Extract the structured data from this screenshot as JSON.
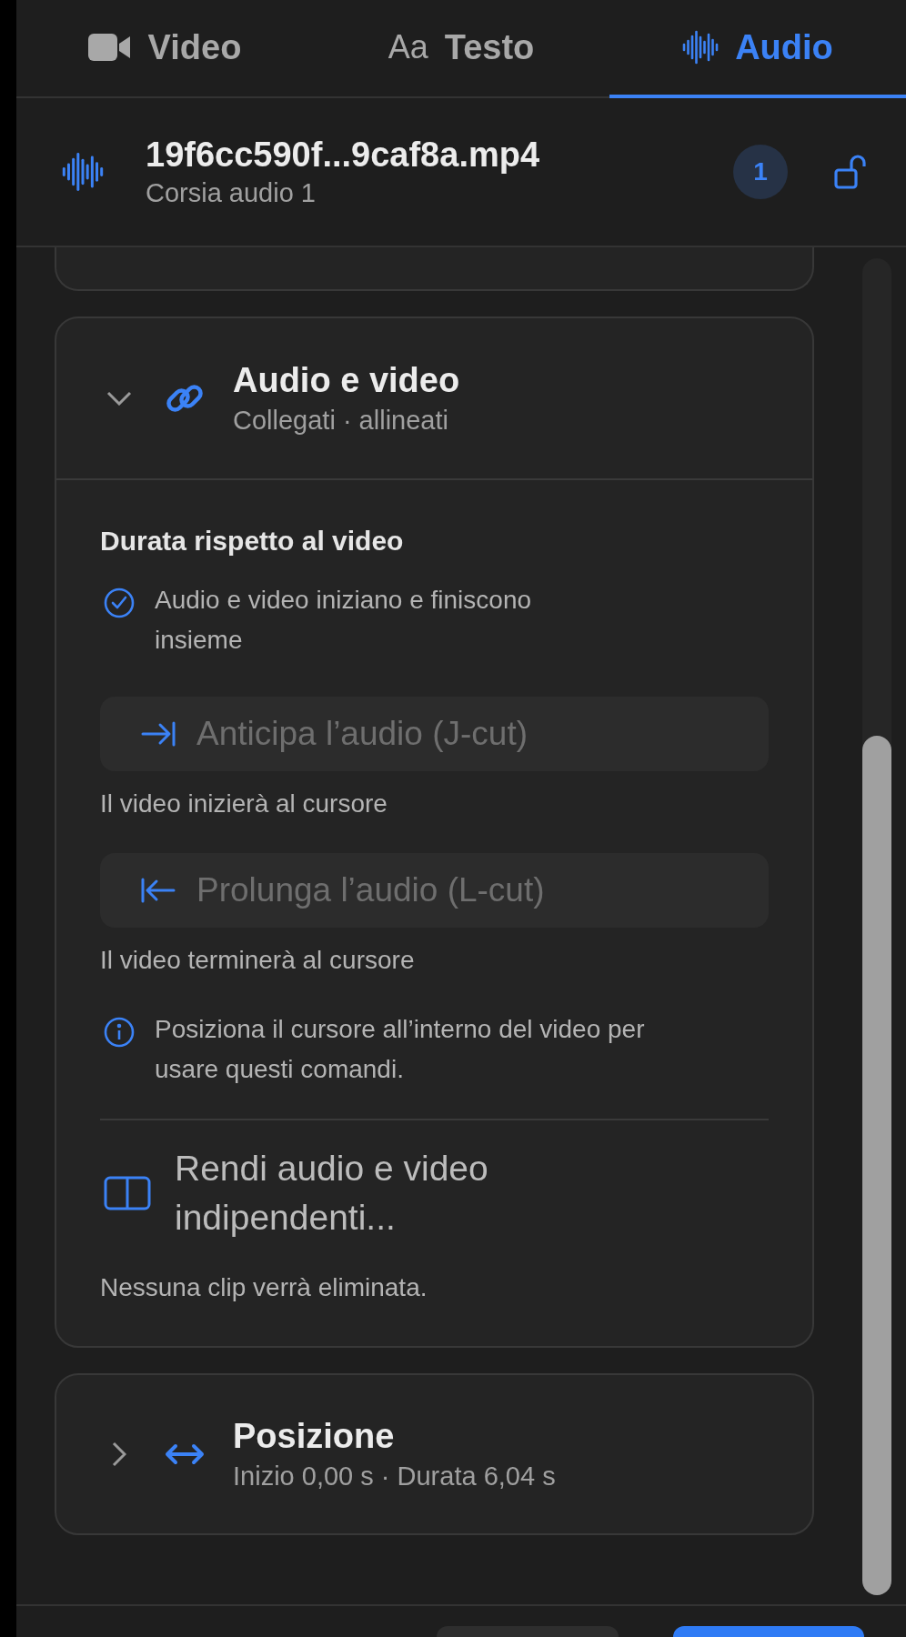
{
  "tabs": [
    {
      "kind": "video",
      "label": "Video",
      "selected": false
    },
    {
      "kind": "text",
      "prefix": "Aa",
      "label": "Testo",
      "selected": false
    },
    {
      "kind": "audio",
      "label": "Audio",
      "selected": true
    }
  ],
  "clip": {
    "title": "19f6cc590f...9caf8a.mp4",
    "subtitle": "Corsia audio 1",
    "badge": "1",
    "locked": false
  },
  "sections": [
    {
      "kind": "link",
      "title": "Audio e video",
      "subtitle": "Collegati · allineati",
      "expanded": true,
      "content": [
        {
          "kind": "heading",
          "text": "Durata rispetto al video"
        },
        {
          "kind": "check",
          "text": "Audio e video iniziano e finiscono insieme"
        },
        {
          "kind": "anticipate",
          "text": "Anticipa l’audio (J-cut)",
          "disabled": true
        },
        {
          "kind": "hint",
          "text": "Il video inizierà al cursore"
        },
        {
          "kind": "extend",
          "text": "Prolunga l’audio (L-cut)",
          "disabled": true
        },
        {
          "kind": "hint",
          "text": "Il video terminerà al cursore"
        },
        {
          "kind": "info",
          "text": "Posiziona il cursore all’interno del video per usare questi comandi."
        },
        {
          "kind": "split",
          "text": "Rendi audio e video indipendenti..."
        },
        {
          "kind": "hint",
          "text": "Nessuna clip verrà eliminata."
        }
      ]
    },
    {
      "kind": "position",
      "title": "Posizione",
      "subtitle": "Inizio 0,00 s · Durata 6,04 s",
      "expanded": false
    }
  ]
}
